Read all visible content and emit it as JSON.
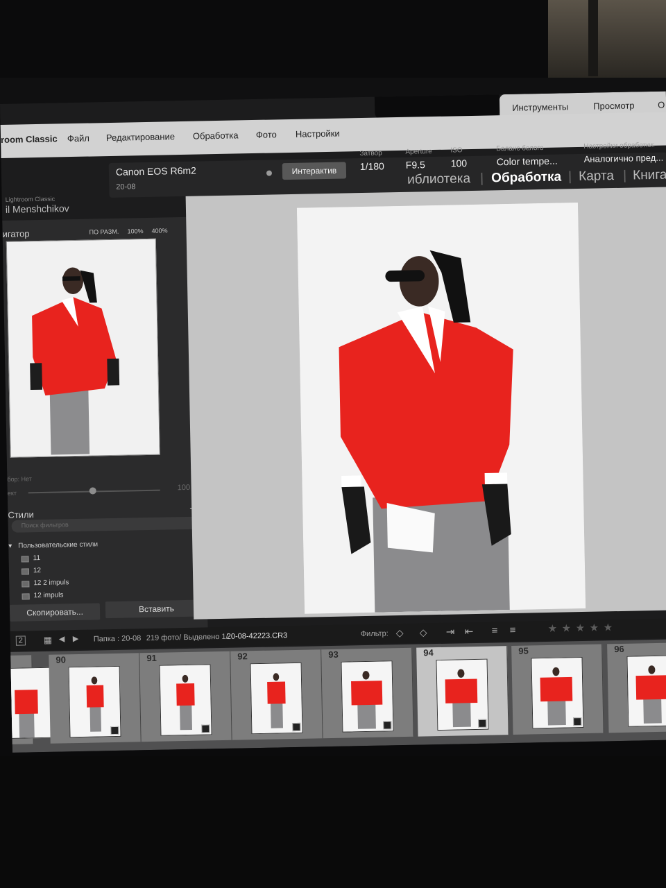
{
  "menu": {
    "app": "room Classic",
    "items": [
      "Файл",
      "Редактирование",
      "Обработка",
      "Фото",
      "Настройки"
    ]
  },
  "tabs": [
    "Инструменты",
    "Просмотр",
    "О"
  ],
  "camera": {
    "name": "Canon EOS R6m2",
    "session": "20-08",
    "interactive_label": "Интерактив",
    "params": [
      {
        "label": "Затвор",
        "value": "1/180"
      },
      {
        "label": "Aperture",
        "value": "F9.5"
      },
      {
        "label": "ISO",
        "value": "100"
      },
      {
        "label": "Баланс белого",
        "value": "Color tempe..."
      },
      {
        "label": "Настройки обработки:",
        "value": "Аналогично пред..."
      }
    ]
  },
  "identity": {
    "app": "Lightroom Classic",
    "name": "il Menshchikov"
  },
  "modules": [
    "иблиотека",
    "Обработка",
    "Карта",
    "Книга"
  ],
  "modules_active": "Обработка",
  "navigator": {
    "title": "игатор",
    "options": [
      "ПО РАЗМ.",
      "100%",
      "400%"
    ]
  },
  "presets_panel": {
    "amount_label": "бор: Нет",
    "effect_label": "ект",
    "effect_value": "100",
    "styles_title": "Стили",
    "search_placeholder": "Поиск фильтров",
    "group": "Пользовательские стили",
    "items": [
      "11",
      "12",
      "12  2 impuls",
      "12 impuls"
    ]
  },
  "buttons": {
    "copy": "Скопировать...",
    "paste": "Вставить"
  },
  "filmstrip_bar": {
    "page": "2",
    "folder": "Папка : 20-08",
    "count": "219 фото/ Выделено 1/",
    "file": "20-08-42223.CR3",
    "filter_label": "Фильтр:"
  },
  "filmstrip": {
    "numbers": [
      "90",
      "91",
      "92",
      "93",
      "94",
      "95",
      "96"
    ],
    "selected_index": 4
  },
  "colors": {
    "accent_red": "#e8231e",
    "trousers": "#8b8b8d",
    "menubar": "#d2d2d2"
  }
}
